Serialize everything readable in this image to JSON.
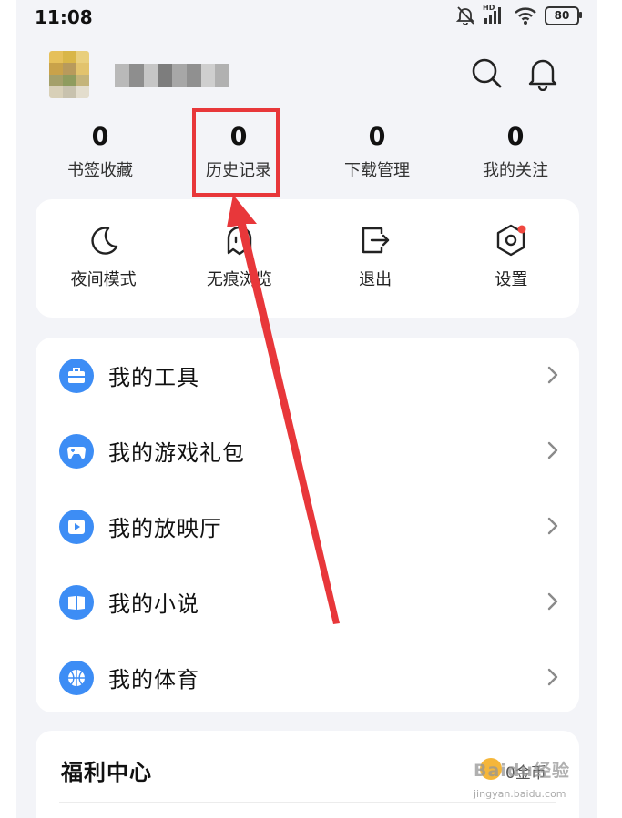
{
  "status_bar": {
    "time": "11:08",
    "hd_label": "HD",
    "battery": "80"
  },
  "stats": [
    {
      "value": "0",
      "label": "书签收藏"
    },
    {
      "value": "0",
      "label": "历史记录"
    },
    {
      "value": "0",
      "label": "下载管理"
    },
    {
      "value": "0",
      "label": "我的关注"
    }
  ],
  "quick_actions": [
    {
      "label": "夜间模式",
      "icon": "moon-icon"
    },
    {
      "label": "无痕浏览",
      "icon": "ghost-icon"
    },
    {
      "label": "退出",
      "icon": "logout-icon"
    },
    {
      "label": "设置",
      "icon": "settings-icon"
    }
  ],
  "menu": [
    {
      "label": "我的工具",
      "icon": "toolbox-icon"
    },
    {
      "label": "我的游戏礼包",
      "icon": "gamepad-icon"
    },
    {
      "label": "我的放映厅",
      "icon": "play-icon"
    },
    {
      "label": "我的小说",
      "icon": "book-icon"
    },
    {
      "label": "我的体育",
      "icon": "basketball-icon"
    }
  ],
  "welfare": {
    "title": "福利中心",
    "coins": "0金币"
  },
  "watermark": {
    "text": "Baidu经验",
    "sub": "jingyan.baidu.com"
  },
  "colors": {
    "accent_blue": "#3d8df5",
    "highlight_red": "#e8373a",
    "background": "#f3f4f8",
    "notification_dot": "#f0473f"
  }
}
